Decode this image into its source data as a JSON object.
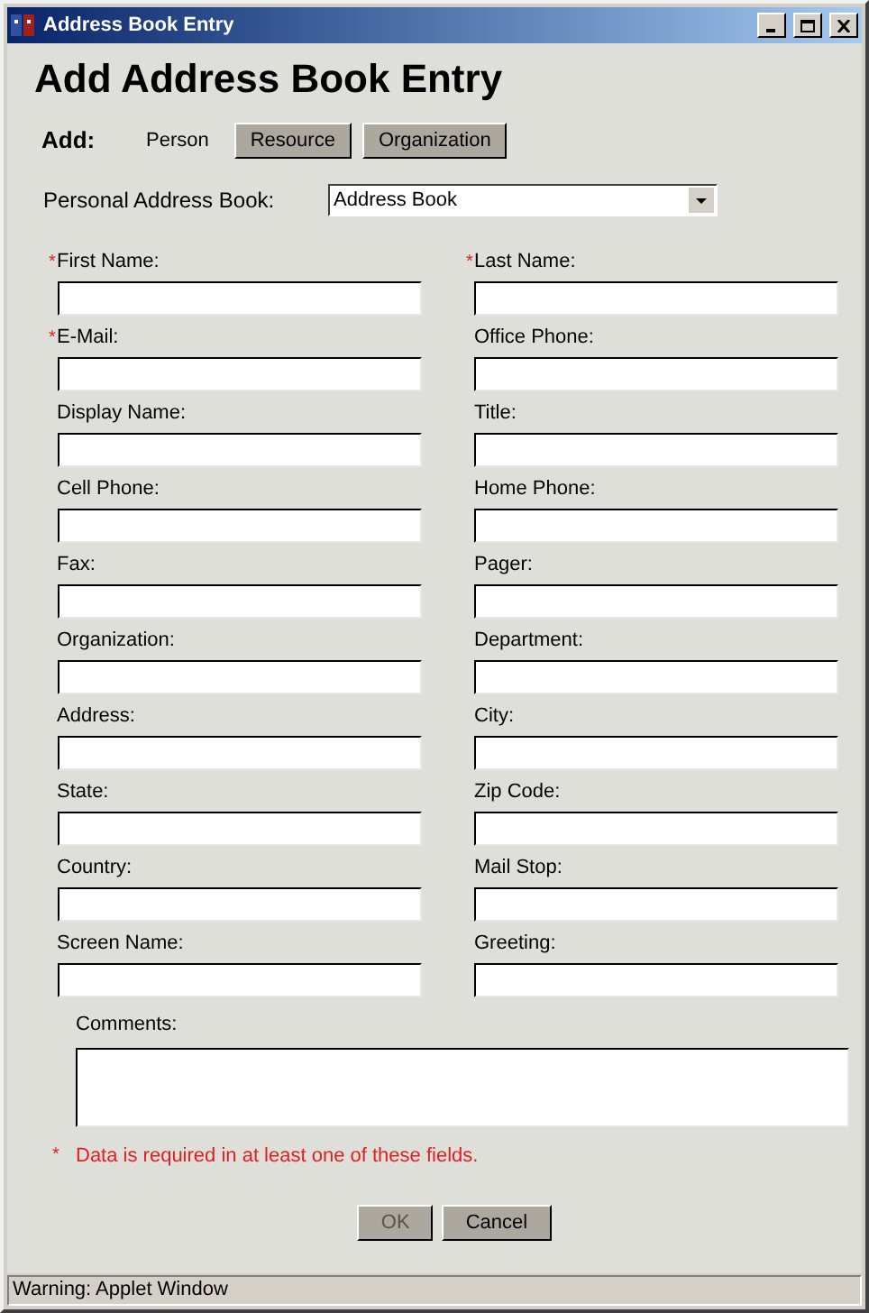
{
  "window": {
    "title": "Address Book Entry"
  },
  "heading": "Add Address Book Entry",
  "add": {
    "label": "Add:",
    "types": [
      {
        "label": "Person",
        "selected": true
      },
      {
        "label": "Resource",
        "selected": false
      },
      {
        "label": "Organization",
        "selected": false
      }
    ]
  },
  "address_book": {
    "label": "Personal Address Book:",
    "value": "Address Book"
  },
  "fields": [
    {
      "label": "First Name:",
      "required": true
    },
    {
      "label": "Last Name:",
      "required": true
    },
    {
      "label": "E-Mail:",
      "required": true
    },
    {
      "label": "Office Phone:",
      "required": false
    },
    {
      "label": "Display Name:",
      "required": false
    },
    {
      "label": "Title:",
      "required": false
    },
    {
      "label": "Cell Phone:",
      "required": false
    },
    {
      "label": "Home Phone:",
      "required": false
    },
    {
      "label": "Fax:",
      "required": false
    },
    {
      "label": "Pager:",
      "required": false
    },
    {
      "label": "Organization:",
      "required": false
    },
    {
      "label": "Department:",
      "required": false
    },
    {
      "label": "Address:",
      "required": false
    },
    {
      "label": "City:",
      "required": false
    },
    {
      "label": "State:",
      "required": false
    },
    {
      "label": "Zip Code:",
      "required": false
    },
    {
      "label": "Country:",
      "required": false
    },
    {
      "label": "Mail Stop:",
      "required": false
    },
    {
      "label": "Screen Name:",
      "required": false
    },
    {
      "label": "Greeting:",
      "required": false
    }
  ],
  "comments": {
    "label": "Comments:"
  },
  "required_note": {
    "mark": "*",
    "text": "Data is required in at least one of these fields."
  },
  "buttons": [
    {
      "label": "OK",
      "disabled": true
    },
    {
      "label": "Cancel",
      "disabled": false
    }
  ],
  "status_bar": "Warning: Applet Window"
}
